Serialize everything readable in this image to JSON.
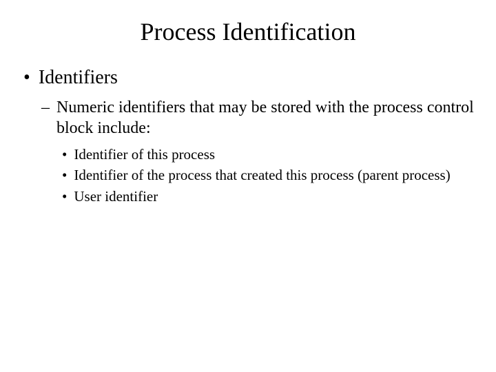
{
  "title": "Process Identification",
  "level1": {
    "item1": "Identifiers"
  },
  "level2": {
    "item1": "Numeric identifiers that may be stored with the process control block include:"
  },
  "level3": {
    "item1": "Identifier of this process",
    "item2": "Identifier of the process that created this process (parent process)",
    "item3": "User identifier"
  },
  "markers": {
    "disc": "•",
    "dash": "–"
  }
}
